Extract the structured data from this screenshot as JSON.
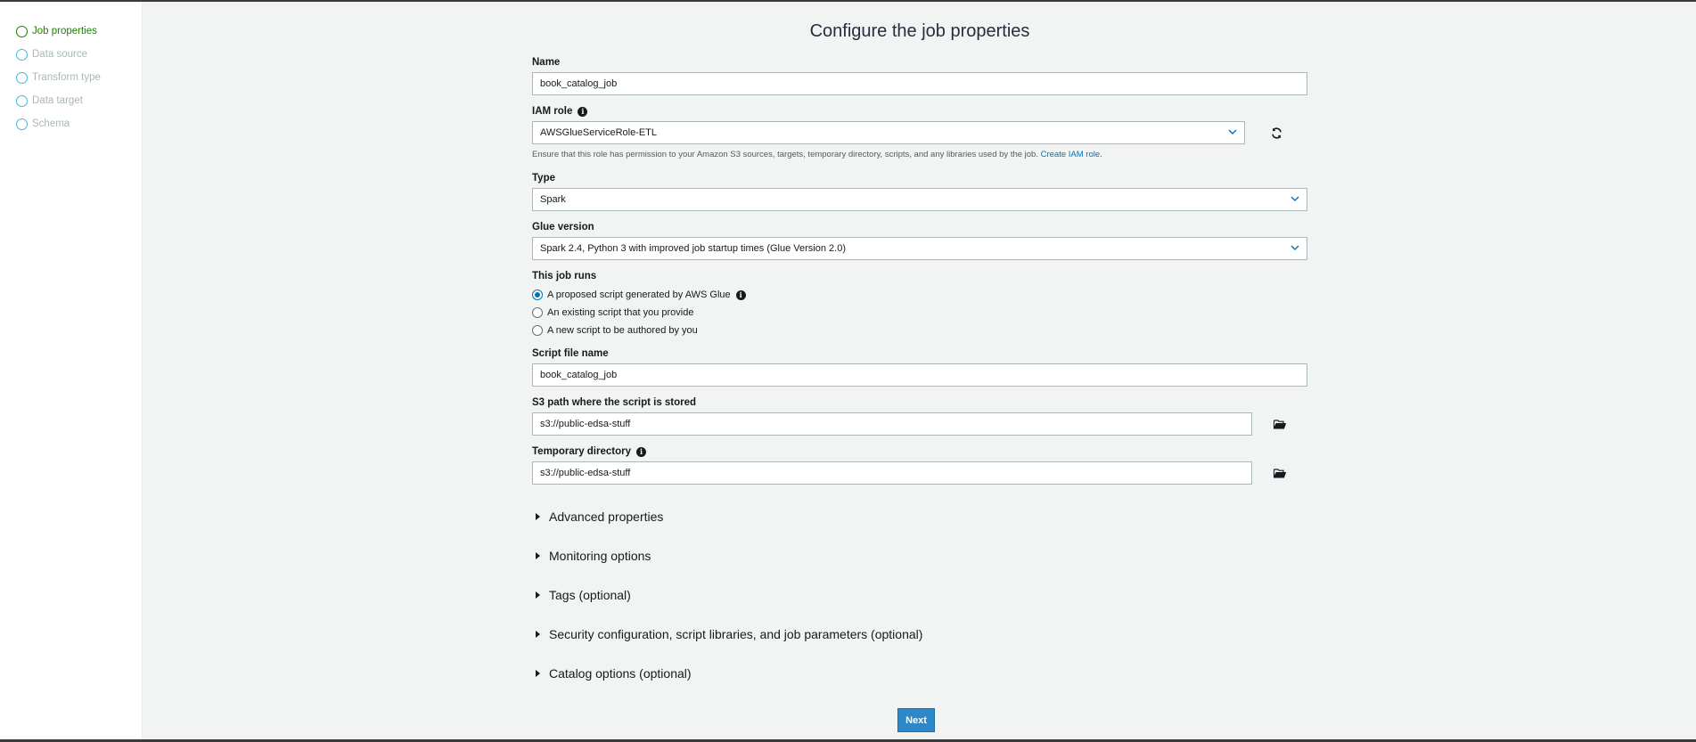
{
  "steps": [
    {
      "label": "Job properties",
      "state": "active"
    },
    {
      "label": "Data source",
      "state": "pending"
    },
    {
      "label": "Transform type",
      "state": "pending"
    },
    {
      "label": "Data target",
      "state": "pending"
    },
    {
      "label": "Schema",
      "state": "pending"
    }
  ],
  "title": "Configure the job properties",
  "name": {
    "label": "Name",
    "value": "book_catalog_job"
  },
  "iam_role": {
    "label": "IAM role",
    "value": "AWSGlueServiceRole-ETL",
    "help_text": "Ensure that this role has permission to your Amazon S3 sources, targets, temporary directory, scripts, and any libraries used by the job.",
    "help_link": "Create IAM role."
  },
  "type": {
    "label": "Type",
    "value": "Spark"
  },
  "glue_version": {
    "label": "Glue version",
    "value": "Spark 2.4, Python 3 with improved job startup times (Glue Version 2.0)"
  },
  "job_runs": {
    "label": "This job runs",
    "options": [
      {
        "label": "A proposed script generated by AWS Glue",
        "checked": true
      },
      {
        "label": "An existing script that you provide",
        "checked": false
      },
      {
        "label": "A new script to be authored by you",
        "checked": false
      }
    ]
  },
  "script_file_name": {
    "label": "Script file name",
    "value": "book_catalog_job"
  },
  "s3_path": {
    "label": "S3 path where the script is stored",
    "value": "s3://public-edsa-stuff"
  },
  "temp_dir": {
    "label": "Temporary directory",
    "value": "s3://public-edsa-stuff"
  },
  "sections": [
    "Advanced properties",
    "Monitoring options",
    "Tags (optional)",
    "Security configuration, script libraries, and job parameters (optional)",
    "Catalog options (optional)"
  ],
  "next_label": "Next",
  "colors": {
    "accent": "#0073bb",
    "active_step": "#1d8102",
    "step_ring": "#44b9d6",
    "next_button": "#2e88c7"
  }
}
